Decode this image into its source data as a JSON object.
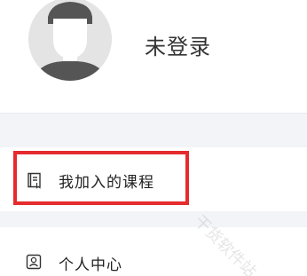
{
  "profile": {
    "avatar_icon": "default-user-avatar-icon",
    "status_text": "未登录"
  },
  "menu": {
    "items": [
      {
        "label": "我加入的课程",
        "icon": "course-book-icon",
        "highlighted": true
      },
      {
        "label": "个人中心",
        "icon": "person-card-icon",
        "highlighted": false
      }
    ]
  },
  "annotation": {
    "highlight_color": "#e52b2b"
  },
  "watermark": {
    "text": "干货软件站"
  }
}
